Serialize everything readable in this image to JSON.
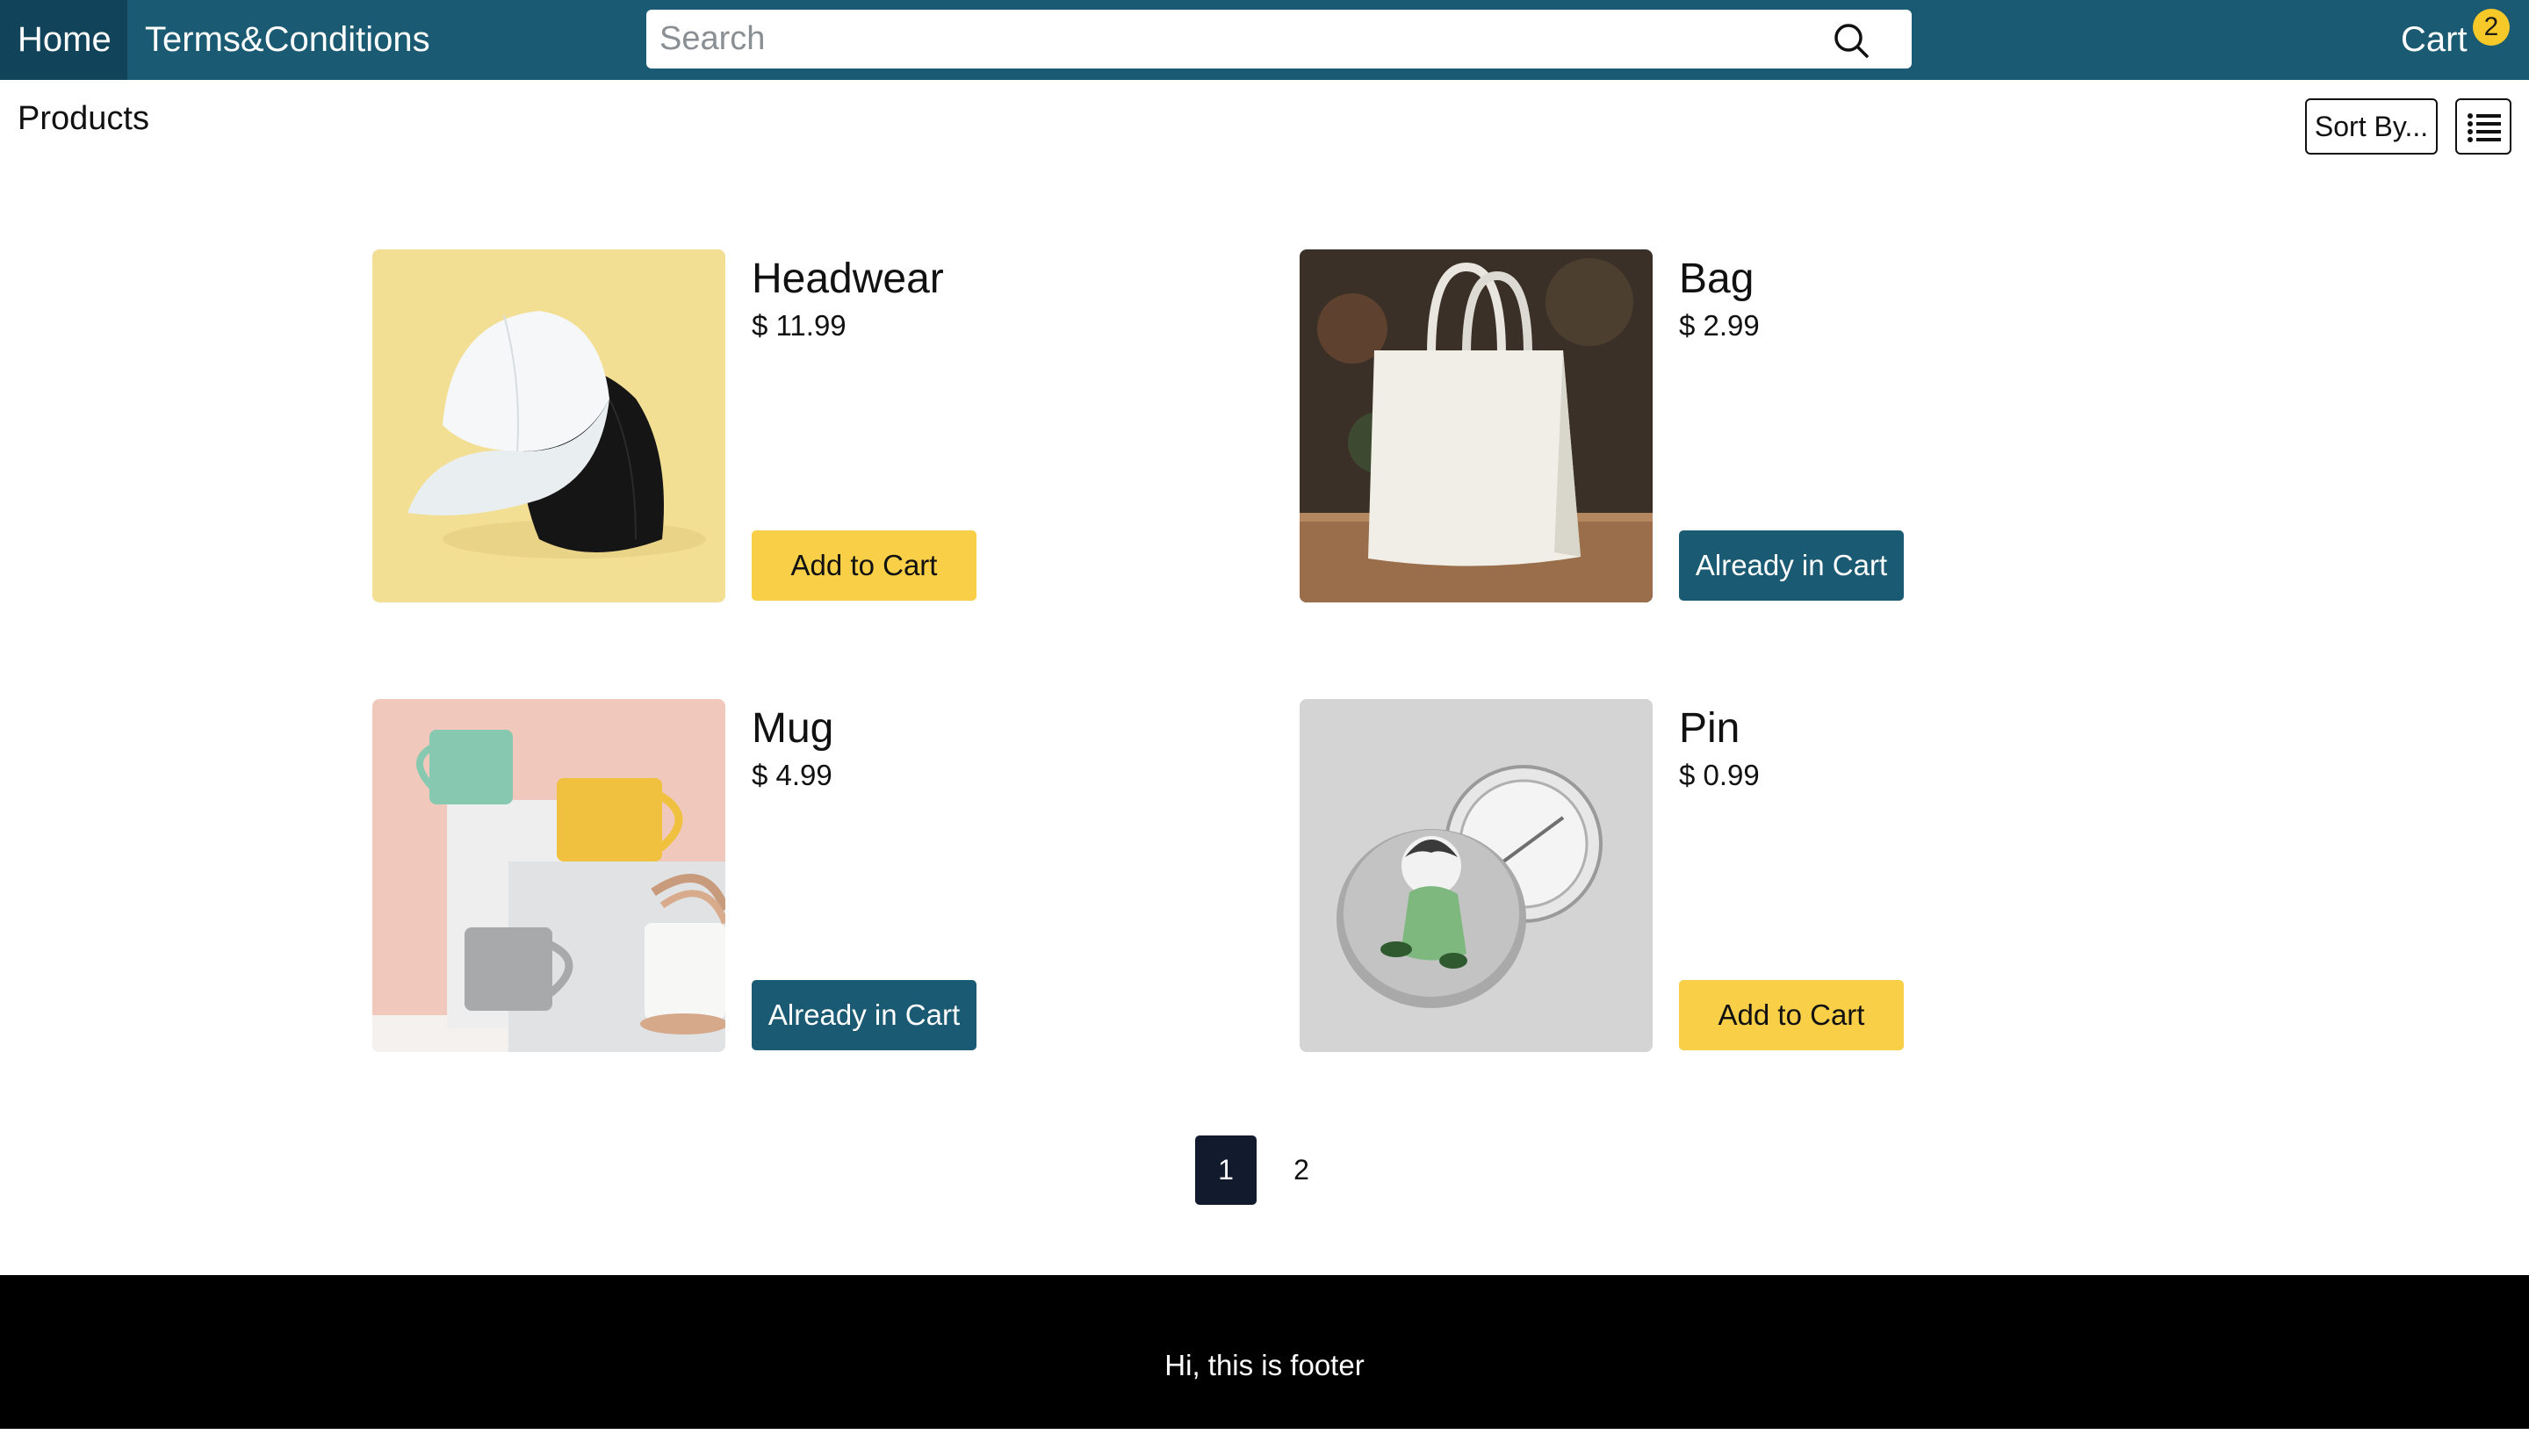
{
  "nav": {
    "home_label": "Home",
    "terms_label": "Terms&Conditions",
    "cart_label": "Cart",
    "cart_count": "2"
  },
  "search": {
    "placeholder": "Search",
    "value": ""
  },
  "header": {
    "title": "Products",
    "sort_label": "Sort By..."
  },
  "products": [
    {
      "name": "Headwear",
      "price": "$ 11.99",
      "button": "Add to Cart",
      "in_cart": false,
      "image": "baseball-caps-image"
    },
    {
      "name": "Bag",
      "price": "$ 2.99",
      "button": "Already in Cart",
      "in_cart": true,
      "image": "tote-bag-image"
    },
    {
      "name": "Mug",
      "price": "$ 4.99",
      "button": "Already in Cart",
      "in_cart": true,
      "image": "mugs-image"
    },
    {
      "name": "Pin",
      "price": "$ 0.99",
      "button": "Add to Cart",
      "in_cart": false,
      "image": "pin-button-image"
    }
  ],
  "pagination": {
    "pages": [
      "1",
      "2"
    ],
    "current": "1"
  },
  "footer": {
    "text": "Hi, this is footer"
  },
  "colors": {
    "navbar": "#1a5a72",
    "nav_active": "#11445a",
    "add_button": "#f8cf47",
    "in_cart_button": "#1a5a72",
    "badge": "#f6c928",
    "footer": "#000000"
  }
}
